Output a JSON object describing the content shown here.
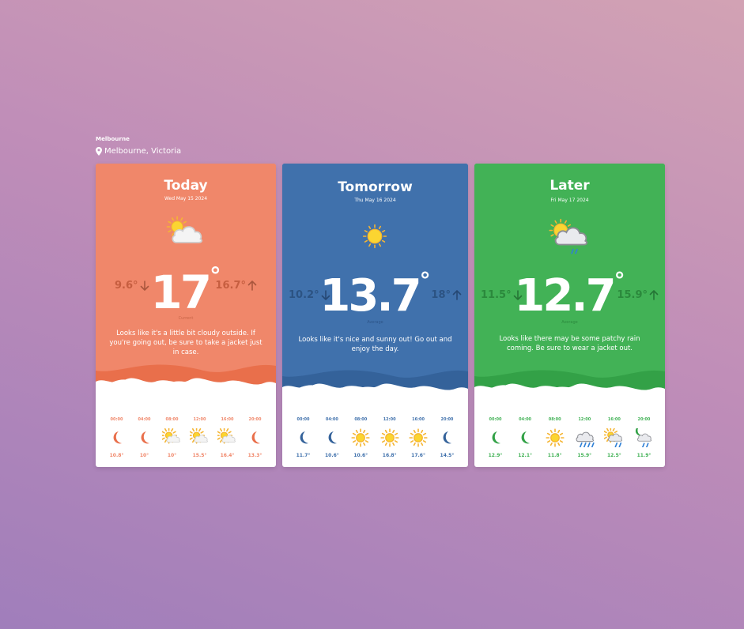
{
  "header": {
    "app_title": "Melbourne",
    "location": "Melbourne, Victoria",
    "location_icon": "map-pin-icon"
  },
  "cards": [
    {
      "title": "Today",
      "date": "Wed May 15 2024",
      "color": "#f0876a",
      "accent": "#e96f4b",
      "main_icon": "partly-cloudy-icon",
      "temp": "17",
      "degree": "°",
      "low": "9.6°",
      "high": "16.7°",
      "caption": "Current",
      "description": "Looks like it's a little bit cloudy outside. If you're going out, be sure to take a jacket just in case.",
      "hours": [
        {
          "time": "00:00",
          "icon": "moon-icon",
          "temp": "10.8°"
        },
        {
          "time": "04:00",
          "icon": "moon-icon",
          "temp": "10°"
        },
        {
          "time": "08:00",
          "icon": "partly-cloudy-icon",
          "temp": "10°"
        },
        {
          "time": "12:00",
          "icon": "partly-cloudy-icon",
          "temp": "15.5°"
        },
        {
          "time": "16:00",
          "icon": "partly-cloudy-icon",
          "temp": "16.4°"
        },
        {
          "time": "20:00",
          "icon": "moon-icon",
          "temp": "13.3°"
        }
      ]
    },
    {
      "title": "Tomorrow",
      "date": "Thu May 16 2024",
      "color": "#4071ac",
      "accent": "#34629a",
      "main_icon": "sun-icon",
      "temp": "13.7",
      "degree": "°",
      "low": "10.2°",
      "high": "18°",
      "caption": "Average",
      "description": "Looks like it's nice and sunny out! Go out and enjoy the day.",
      "hours": [
        {
          "time": "00:00",
          "icon": "moon-icon",
          "temp": "11.7°"
        },
        {
          "time": "04:00",
          "icon": "moon-icon",
          "temp": "10.6°"
        },
        {
          "time": "08:00",
          "icon": "sun-icon",
          "temp": "10.6°"
        },
        {
          "time": "12:00",
          "icon": "sun-icon",
          "temp": "16.8°"
        },
        {
          "time": "16:00",
          "icon": "sun-icon",
          "temp": "17.6°"
        },
        {
          "time": "20:00",
          "icon": "moon-icon",
          "temp": "14.5°"
        }
      ]
    },
    {
      "title": "Later",
      "date": "Fri May 17 2024",
      "color": "#42b256",
      "accent": "#33a147",
      "main_icon": "sun-rain-icon",
      "temp": "12.7",
      "degree": "°",
      "low": "11.5°",
      "high": "15.9°",
      "caption": "Average",
      "description": "Looks like there may be some patchy rain coming. Be sure to wear a jacket out.",
      "hours": [
        {
          "time": "00:00",
          "icon": "moon-icon",
          "temp": "12.9°"
        },
        {
          "time": "04:00",
          "icon": "moon-icon",
          "temp": "12.1°"
        },
        {
          "time": "08:00",
          "icon": "sun-icon",
          "temp": "11.8°"
        },
        {
          "time": "12:00",
          "icon": "drizzle-icon",
          "temp": "15.9°"
        },
        {
          "time": "16:00",
          "icon": "sun-rain-icon",
          "temp": "12.5°"
        },
        {
          "time": "20:00",
          "icon": "moon-rain-icon",
          "temp": "11.9°"
        }
      ]
    }
  ]
}
